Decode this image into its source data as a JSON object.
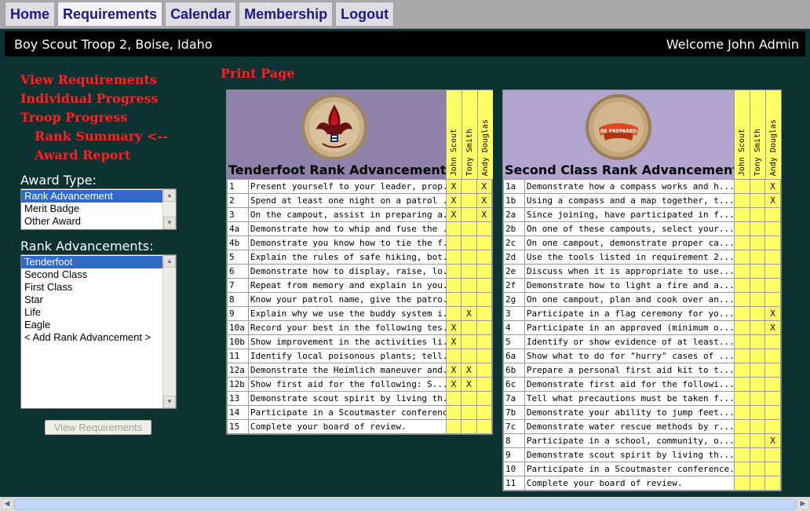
{
  "nav": {
    "tabs": [
      {
        "label": "Home",
        "active": false
      },
      {
        "label": "Requirements",
        "active": true
      },
      {
        "label": "Calendar",
        "active": false
      },
      {
        "label": "Membership",
        "active": false
      },
      {
        "label": "Logout",
        "active": false
      }
    ]
  },
  "header": {
    "troop": "Boy Scout Troop 2, Boise, Idaho",
    "welcome": "Welcome John Admin"
  },
  "sidebar": {
    "links": [
      {
        "label": "View Requirements"
      },
      {
        "label": "Individual Progress"
      },
      {
        "label": "Troop Progress"
      },
      {
        "label": "Rank Summary <--"
      },
      {
        "label": "Award Report"
      }
    ],
    "award_type_label": "Award Type:",
    "award_types": [
      "Rank Advancement",
      "Merit Badge",
      "Other Award"
    ],
    "award_selected": 0,
    "rank_label": "Rank Advancements:",
    "ranks": [
      "Tenderfoot",
      "Second Class",
      "First Class",
      "Star",
      "Life",
      "Eagle",
      "< Add Rank Advancement >"
    ],
    "rank_selected": 0,
    "view_button": "View Requirements"
  },
  "print_link": "Print Page",
  "scouts": [
    "John Scout",
    "Tony Smith",
    "Andy Douglas"
  ],
  "tenderfoot": {
    "title": "Tenderfoot Rank Advancement",
    "rows": [
      {
        "num": "1",
        "text": "Present yourself to your leader, prop...",
        "marks": [
          "X",
          "",
          "X"
        ]
      },
      {
        "num": "2",
        "text": "Spend at least one night on a patrol ...",
        "marks": [
          "X",
          "",
          "X"
        ]
      },
      {
        "num": "3",
        "text": "On the campout, assist in preparing a...",
        "marks": [
          "X",
          "",
          "X"
        ]
      },
      {
        "num": "4a",
        "text": "Demonstrate how to whip and fuse the ...",
        "marks": [
          "",
          "",
          ""
        ]
      },
      {
        "num": "4b",
        "text": "Demonstrate you know how to tie the f...",
        "marks": [
          "",
          "",
          ""
        ]
      },
      {
        "num": "5",
        "text": "Explain the rules of safe hiking, bot...",
        "marks": [
          "",
          "",
          ""
        ]
      },
      {
        "num": "6",
        "text": "Demonstrate how to display, raise, lo...",
        "marks": [
          "",
          "",
          ""
        ]
      },
      {
        "num": "7",
        "text": "Repeat from memory and explain in you...",
        "marks": [
          "",
          "",
          ""
        ]
      },
      {
        "num": "8",
        "text": "Know your patrol name, give the patro...",
        "marks": [
          "",
          "",
          ""
        ]
      },
      {
        "num": "9",
        "text": "Explain why we use the buddy system i...",
        "marks": [
          "",
          "X",
          ""
        ]
      },
      {
        "num": "10a",
        "text": "Record your best in the following tes...",
        "marks": [
          "X",
          "",
          ""
        ]
      },
      {
        "num": "10b",
        "text": "Show improvement in the activities li...",
        "marks": [
          "X",
          "",
          ""
        ]
      },
      {
        "num": "11",
        "text": "Identify local poisonous plants; tell...",
        "marks": [
          "",
          "",
          ""
        ]
      },
      {
        "num": "12a",
        "text": "Demonstrate the Heimlich maneuver and...",
        "marks": [
          "X",
          "X",
          ""
        ]
      },
      {
        "num": "12b",
        "text": "Show first aid for the following: S...",
        "marks": [
          "X",
          "X",
          ""
        ]
      },
      {
        "num": "13",
        "text": "Demonstrate scout spirit by living th...",
        "marks": [
          "",
          "",
          ""
        ]
      },
      {
        "num": "14",
        "text": "Participate in a Scoutmaster conference.",
        "marks": [
          "",
          "",
          ""
        ]
      },
      {
        "num": "15",
        "text": "Complete your board of review.",
        "marks": [
          "",
          "",
          ""
        ]
      }
    ]
  },
  "secondclass": {
    "title": "Second Class Rank Advancement",
    "badge_text": "BE PREPARED",
    "rows": [
      {
        "num": "1a",
        "text": "Demonstrate how a compass works and h...",
        "marks": [
          "",
          "",
          "X"
        ]
      },
      {
        "num": "1b",
        "text": "Using a compass and a map together, t...",
        "marks": [
          "",
          "",
          "X"
        ]
      },
      {
        "num": "2a",
        "text": "Since joining, have participated in f...",
        "marks": [
          "",
          "",
          ""
        ]
      },
      {
        "num": "2b",
        "text": "On one of these campouts, select your...",
        "marks": [
          "",
          "",
          ""
        ]
      },
      {
        "num": "2c",
        "text": "On one campout, demonstrate proper ca...",
        "marks": [
          "",
          "",
          ""
        ]
      },
      {
        "num": "2d",
        "text": "Use the tools listed in requirement 2...",
        "marks": [
          "",
          "",
          ""
        ]
      },
      {
        "num": "2e",
        "text": "Discuss when it is appropriate to use...",
        "marks": [
          "",
          "",
          ""
        ]
      },
      {
        "num": "2f",
        "text": "Demonstrate how to light a fire and a...",
        "marks": [
          "",
          "",
          ""
        ]
      },
      {
        "num": "2g",
        "text": "On one campout, plan and cook over an...",
        "marks": [
          "",
          "",
          ""
        ]
      },
      {
        "num": "3",
        "text": "Participate in a flag ceremony for yo...",
        "marks": [
          "",
          "",
          "X"
        ]
      },
      {
        "num": "4",
        "text": "Participate in an approved (minimum o...",
        "marks": [
          "",
          "",
          "X"
        ]
      },
      {
        "num": "5",
        "text": "Identify or show evidence of at least...",
        "marks": [
          "",
          "",
          ""
        ]
      },
      {
        "num": "6a",
        "text": "Show what to do for \"hurry\" cases of ...",
        "marks": [
          "",
          "",
          ""
        ]
      },
      {
        "num": "6b",
        "text": "Prepare a personal first aid kit to t...",
        "marks": [
          "",
          "",
          ""
        ]
      },
      {
        "num": "6c",
        "text": "Demonstrate first aid for the followi...",
        "marks": [
          "",
          "",
          ""
        ]
      },
      {
        "num": "7a",
        "text": "Tell what precautions must be taken f...",
        "marks": [
          "",
          "",
          ""
        ]
      },
      {
        "num": "7b",
        "text": "Demonstrate your ability to jump feet...",
        "marks": [
          "",
          "",
          ""
        ]
      },
      {
        "num": "7c",
        "text": "Demonstrate water rescue methods by r...",
        "marks": [
          "",
          "",
          ""
        ]
      },
      {
        "num": "8",
        "text": "Participate in a school, community, o...",
        "marks": [
          "",
          "",
          "X"
        ]
      },
      {
        "num": "9",
        "text": "Demonstrate scout spirit by living th...",
        "marks": [
          "",
          "",
          ""
        ]
      },
      {
        "num": "10",
        "text": "Participate in a Scoutmaster conference.",
        "marks": [
          "",
          "",
          ""
        ]
      },
      {
        "num": "11",
        "text": "Complete your board of review.",
        "marks": [
          "",
          "",
          ""
        ]
      }
    ]
  },
  "colors": {
    "background": "#0d3232",
    "link": "#ff2020",
    "check_cell": "#ffff66",
    "nav_text": "#1a1a8c"
  }
}
